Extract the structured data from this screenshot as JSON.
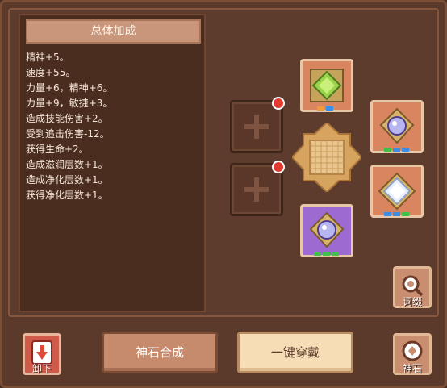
{
  "bonus": {
    "title": "总体加成",
    "items": [
      "精神+5。",
      "速度+55。",
      "力量+6，精神+6。",
      "力量+9，敏捷+3。",
      "造成技能伤害+2。",
      "受到追击伤害-12。",
      "获得生命+2。",
      "造成滋润层数+1。",
      "造成净化层数+1。",
      "获得净化层数+1。"
    ]
  },
  "gems": {
    "top": {
      "icon": "green-gem-icon",
      "color": "#9ad34a"
    },
    "right_top": {
      "icon": "crystal-gem-icon"
    },
    "right_bottom": {
      "icon": "white-diamond-gem-icon"
    },
    "bottom": {
      "icon": "crystal-gem-icon"
    }
  },
  "buttons": {
    "unequip": "卸下",
    "synthesize": "神石合成",
    "one_click_equip": "一键穿戴",
    "affix": "词缀",
    "godstone": "神石"
  },
  "colors": {
    "red_dot": "#e23a2e",
    "dot_orange": "#f09a3a",
    "dot_blue": "#3b8ee6",
    "dot_green": "#3ec24a"
  }
}
